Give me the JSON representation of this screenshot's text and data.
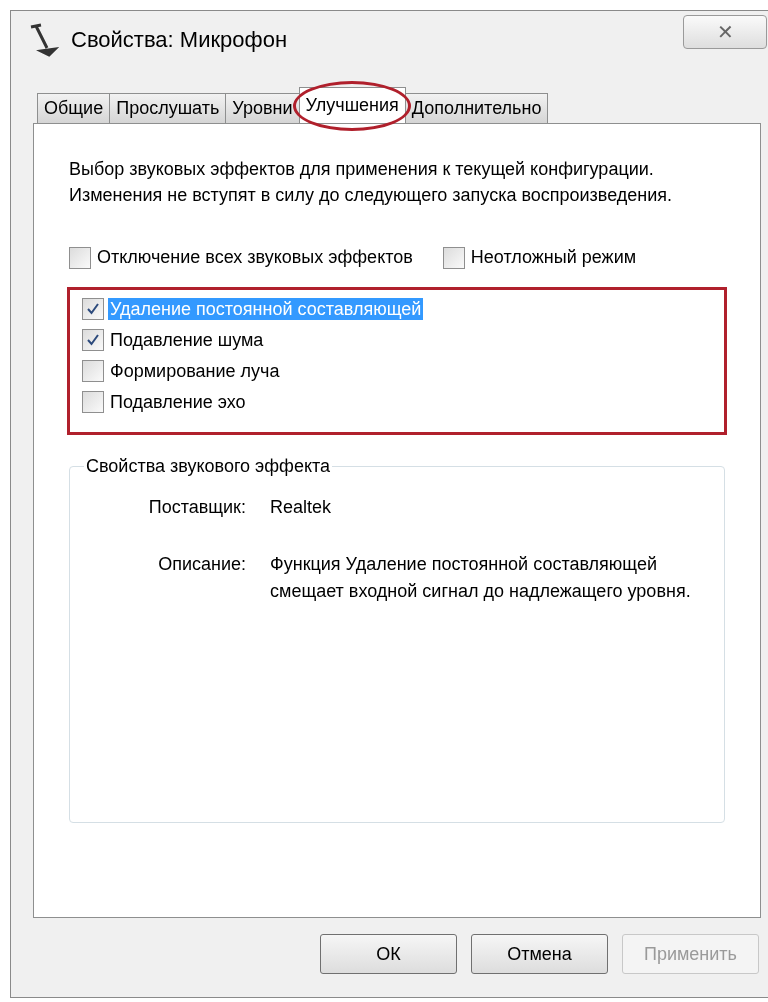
{
  "window": {
    "title": "Свойства: Микрофон",
    "close": "✕"
  },
  "tabs": [
    {
      "label": "Общие",
      "selected": false,
      "circled": false
    },
    {
      "label": "Прослушать",
      "selected": false,
      "circled": false
    },
    {
      "label": "Уровни",
      "selected": false,
      "circled": false
    },
    {
      "label": "Улучшения",
      "selected": true,
      "circled": true
    },
    {
      "label": "Дополнительно",
      "selected": false,
      "circled": false
    }
  ],
  "description": "Выбор звуковых эффектов для применения к текущей конфигурации. Изменения не вступят в силу до следующего запуска воспроизведения.",
  "options": [
    {
      "label": "Отключение всех звуковых эффектов",
      "checked": false
    },
    {
      "label": "Неотложный режим",
      "checked": false
    }
  ],
  "effects": {
    "outlined": true,
    "items": [
      {
        "label": "Удаление постоянной составляющей",
        "checked": true,
        "selected": true
      },
      {
        "label": "Подавление шума",
        "checked": true,
        "selected": false
      },
      {
        "label": "Формирование луча",
        "checked": false,
        "selected": false
      },
      {
        "label": "Подавление эхо",
        "checked": false,
        "selected": false
      }
    ]
  },
  "properties": {
    "title": "Свойства звукового эффекта",
    "rows": [
      {
        "label": "Поставщик:",
        "value": "Realtek"
      },
      {
        "label": "Описание:",
        "value": "Функция Удаление постоянной составляющей смещает входной сигнал до надлежащего уровня."
      }
    ]
  },
  "buttons": [
    {
      "label": "ОК",
      "disabled": false
    },
    {
      "label": "Отмена",
      "disabled": false
    },
    {
      "label": "Применить",
      "disabled": true
    }
  ]
}
